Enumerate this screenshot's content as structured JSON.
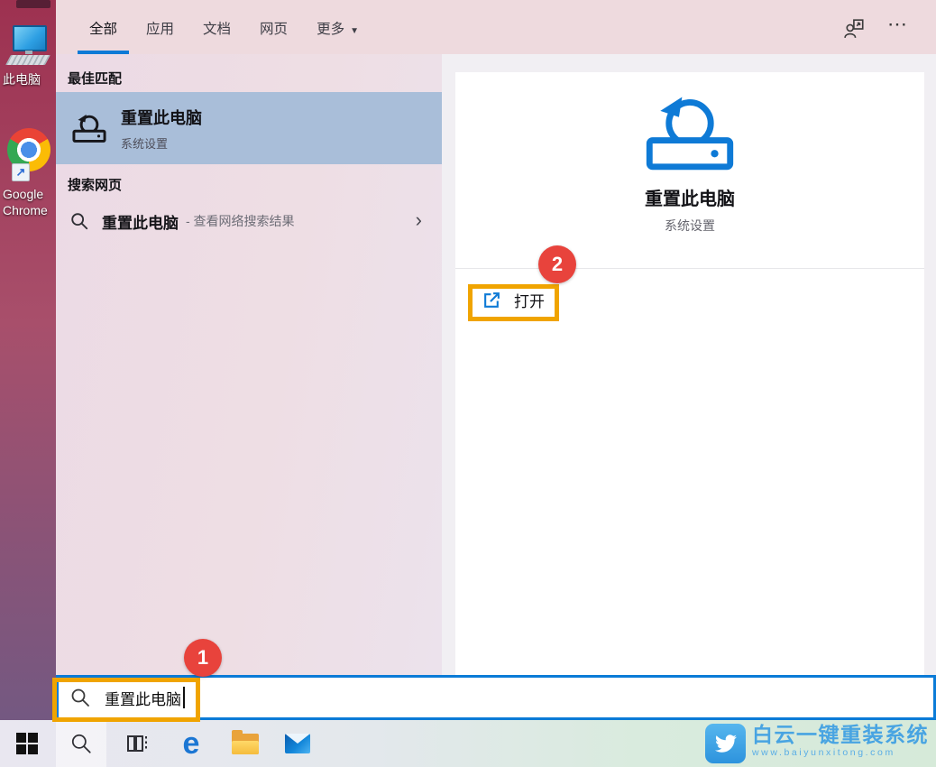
{
  "desktop": {
    "this_pc_label": "此电脑",
    "chrome_label_line1": "Google",
    "chrome_label_line2": "Chrome"
  },
  "search": {
    "tabs": {
      "all": "全部",
      "apps": "应用",
      "documents": "文档",
      "web": "网页",
      "more": "更多"
    },
    "more_caret": "▼",
    "ellipsis": "⋯",
    "best_match_header": "最佳匹配",
    "best_match_title": "重置此电脑",
    "best_match_subtitle": "系统设置",
    "web_header": "搜索网页",
    "web_query": "重置此电脑",
    "web_hint": "- 查看网络搜索结果",
    "chevron": "›",
    "preview_title": "重置此电脑",
    "preview_subtitle": "系统设置",
    "open_label": "打开",
    "search_value": "重置此电脑"
  },
  "annotations": {
    "step1": "1",
    "step2": "2"
  },
  "taskbar": {
    "edge_letter": "e"
  },
  "watermark": {
    "title": "白云一键重装系统",
    "url": "www.baiyunxitong.com"
  },
  "colors": {
    "accent_blue": "#0e7ad6",
    "highlight_row": "#a9bed9",
    "annotation_orange": "#f0a400",
    "badge_red": "#e8433c"
  }
}
